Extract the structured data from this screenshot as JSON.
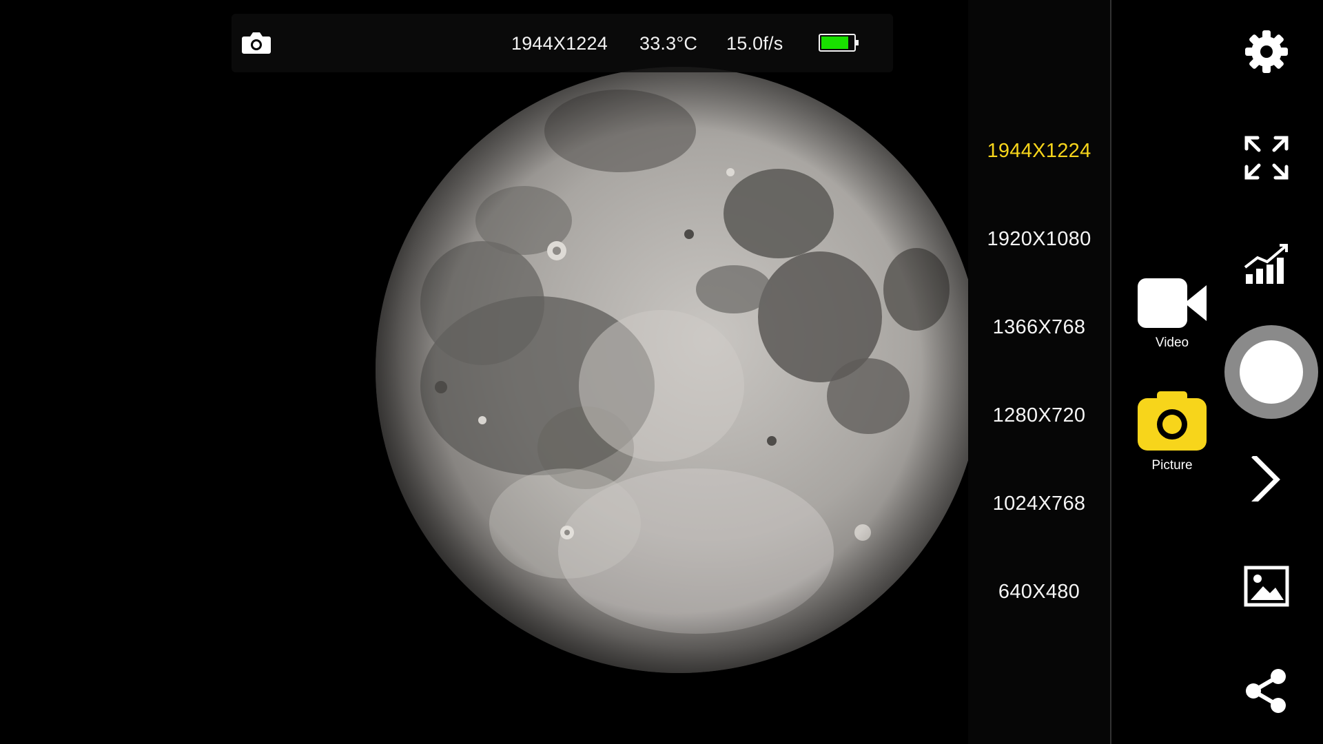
{
  "status_bar": {
    "capture_icon": "camera-icon",
    "resolution": "1944X1224",
    "temperature": "33.3°C",
    "frame_rate": "15.0f/s",
    "battery_level": 0.85,
    "battery_color": "#19e000"
  },
  "resolution_menu": {
    "selected_index": 0,
    "selected_color": "#f7d51b",
    "items": [
      "1944X1224",
      "1920X1080",
      "1366X768",
      "1280X720",
      "1024X768",
      "640X480"
    ]
  },
  "capture_modes": {
    "video_label": "Video",
    "video_icon": "video-camera-icon",
    "picture_label": "Picture",
    "picture_icon": "camera-icon",
    "active_mode": "Picture",
    "active_color": "#f7d51b"
  },
  "side_toolbar": {
    "icons": [
      "gear-icon",
      "fullscreen-icon",
      "chart-icon",
      "shutter-button",
      "chevron-right-icon",
      "gallery-icon",
      "share-icon"
    ]
  }
}
